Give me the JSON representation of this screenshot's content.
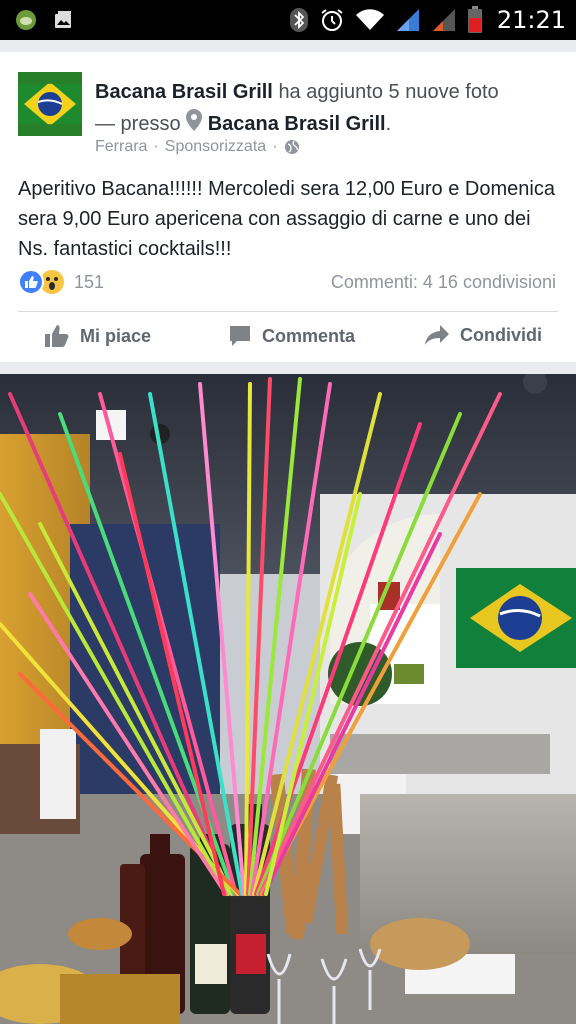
{
  "status_bar": {
    "time": "21:21",
    "icons": [
      "app-icon",
      "gallery-icon",
      "bluetooth-icon",
      "alarm-icon",
      "wifi-icon",
      "signal-icon",
      "signal-icon-2",
      "battery-icon"
    ]
  },
  "post": {
    "page_name": "Bacana Brasil Grill",
    "action_text": "ha aggiunto 5 nuove foto",
    "presso_text": "— presso",
    "location_name": "Bacana Brasil Grill",
    "location_period": ".",
    "meta_location": "Ferrara",
    "meta_sep1": "·",
    "meta_sponsored": "Sponsorizzata",
    "meta_sep2": "·",
    "body": "Aperitivo Bacana!!!!!! Mercoledi sera 12,00 Euro e Domenica sera 9,00 Euro apericena con assaggio di carne e uno dei Ns. fantastici cocktails!!!",
    "reaction_count": "151",
    "comments_count": "Commenti: 4",
    "shares_count": "16 condivisioni",
    "reaction_icons": [
      "like-reaction-icon",
      "wow-reaction-icon"
    ]
  },
  "actions": {
    "like_label": "Mi piace",
    "comment_label": "Commenta",
    "share_label": "Condividi"
  },
  "colors": {
    "brand_blue": "#4080ff",
    "text_primary": "#1d2129",
    "text_secondary": "#90949c",
    "action_grey": "#606770",
    "background": "#e9ebee"
  }
}
